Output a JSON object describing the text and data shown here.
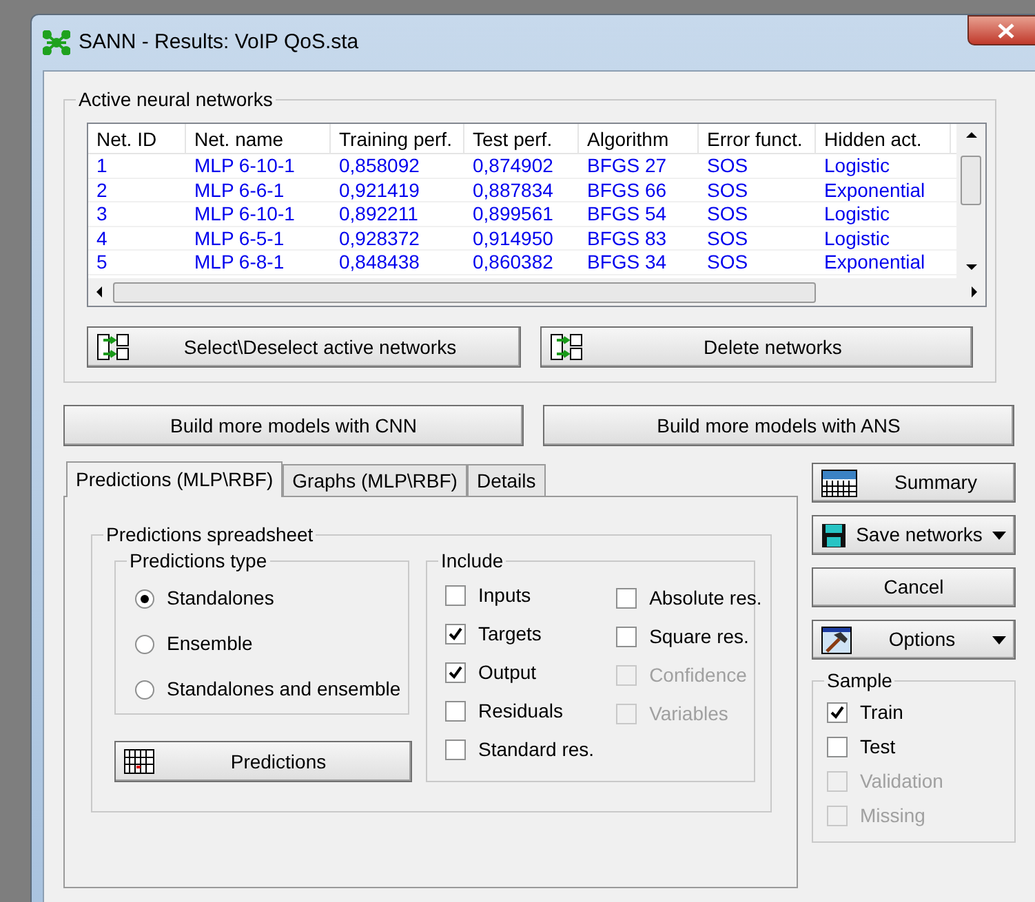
{
  "window": {
    "title": "SANN - Results: VoIP QoS.sta"
  },
  "networks_group": {
    "title": "Active neural networks",
    "columns": [
      "Net. ID",
      "Net. name",
      "Training perf.",
      "Test perf.",
      "Algorithm",
      "Error funct.",
      "Hidden act."
    ],
    "rows": [
      [
        "1",
        "MLP 6-10-1",
        "0,858092",
        "0,874902",
        "BFGS 27",
        "SOS",
        "Logistic"
      ],
      [
        "2",
        "MLP 6-6-1",
        "0,921419",
        "0,887834",
        "BFGS 66",
        "SOS",
        "Exponential"
      ],
      [
        "3",
        "MLP 6-10-1",
        "0,892211",
        "0,899561",
        "BFGS 54",
        "SOS",
        "Logistic"
      ],
      [
        "4",
        "MLP 6-5-1",
        "0,928372",
        "0,914950",
        "BFGS 83",
        "SOS",
        "Logistic"
      ],
      [
        "5",
        "MLP 6-8-1",
        "0,848438",
        "0,860382",
        "BFGS 34",
        "SOS",
        "Exponential"
      ]
    ],
    "buttons": [
      "Select\\Deselect active networks",
      "Delete networks"
    ]
  },
  "build_buttons": [
    "Build more models with CNN",
    "Build more models with ANS"
  ],
  "tabs": [
    {
      "label": "Predictions (MLP\\RBF)",
      "selected": true
    },
    {
      "label": "Graphs (MLP\\RBF)",
      "selected": false
    },
    {
      "label": "Details",
      "selected": false
    }
  ],
  "predictions_spreadsheet": {
    "title": "Predictions spreadsheet",
    "type_group": {
      "title": "Predictions type",
      "options": [
        {
          "label": "Standalones",
          "selected": true
        },
        {
          "label": "Ensemble",
          "selected": false
        },
        {
          "label": "Standalones and ensemble",
          "selected": false
        }
      ]
    },
    "predictions_button": "Predictions",
    "include": {
      "title": "Include",
      "columns": [
        [
          {
            "label": "Inputs",
            "checked": false,
            "disabled": false
          },
          {
            "label": "Targets",
            "checked": true,
            "disabled": false
          },
          {
            "label": "Output",
            "checked": true,
            "disabled": false
          },
          {
            "label": "Residuals",
            "checked": false,
            "disabled": false
          },
          {
            "label": "Standard res.",
            "checked": false,
            "disabled": false
          }
        ],
        [
          {
            "label": "Absolute res.",
            "checked": false,
            "disabled": false
          },
          {
            "label": "Square res.",
            "checked": false,
            "disabled": false
          },
          {
            "label": "Confidence",
            "checked": false,
            "disabled": true
          },
          {
            "label": "Variables",
            "checked": false,
            "disabled": true
          }
        ]
      ]
    }
  },
  "side_buttons": [
    {
      "kind": "icon",
      "label": "Summary"
    },
    {
      "kind": "icon-menu",
      "label": "Save networks"
    },
    {
      "kind": "plain",
      "label": "Cancel"
    },
    {
      "kind": "icon-menu",
      "label": "Options"
    }
  ],
  "sample": {
    "title": "Sample",
    "items": [
      {
        "label": "Train",
        "checked": true,
        "disabled": false
      },
      {
        "label": "Test",
        "checked": false,
        "disabled": false
      },
      {
        "label": "Validation",
        "checked": false,
        "disabled": true
      },
      {
        "label": "Missing",
        "checked": false,
        "disabled": true
      }
    ]
  }
}
